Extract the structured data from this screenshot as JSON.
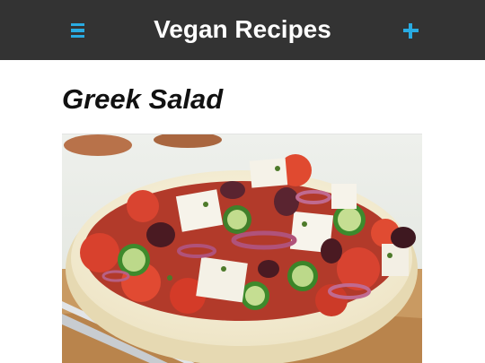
{
  "header": {
    "title": "Vegan Recipes",
    "left_icon": "hamburger-menu-icon",
    "right_icon": "plus-icon",
    "background": "#333333",
    "accent": "#29abe2"
  },
  "recipe": {
    "title": "Greek Salad",
    "image_icon": "greek-salad-photo"
  }
}
